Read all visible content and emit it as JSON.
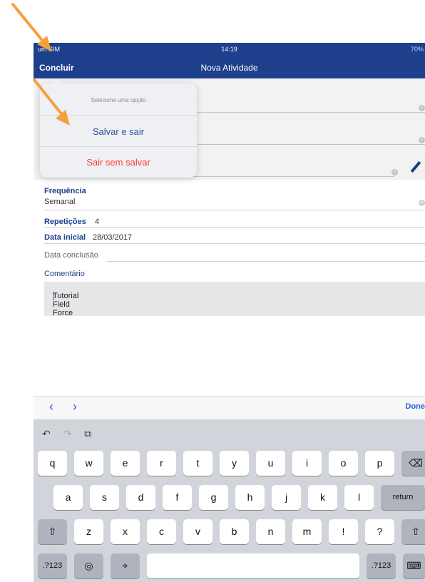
{
  "status": {
    "carrier": "um SIM",
    "time": "14:19",
    "battery": "70%"
  },
  "nav": {
    "left_button": "Concluir",
    "title": "Nova Atividade"
  },
  "popover": {
    "hint": "Selecione uma opção",
    "save_exit": "Salvar e sair",
    "exit_no_save": "Sair sem salvar"
  },
  "form": {
    "frequencia_label": "Frequência",
    "frequencia_value": "Semanal",
    "repeticoes_label": "Repetições",
    "repeticoes_value": "4",
    "data_inicial_label": "Data inicial",
    "data_inicial_value": "28/03/2017",
    "data_conclusao_label": "Data conclusão",
    "comentario_label": "Comentário",
    "comentario_value": "Tutorial Field Force"
  },
  "accessory": {
    "prev": "‹",
    "next": "›",
    "done": "Done"
  },
  "keyboard": {
    "row1": [
      "q",
      "w",
      "e",
      "r",
      "t",
      "y",
      "u",
      "i",
      "o",
      "p"
    ],
    "row2": [
      "a",
      "s",
      "d",
      "f",
      "g",
      "h",
      "j",
      "k",
      "l"
    ],
    "row3": [
      "z",
      "x",
      "c",
      "v",
      "b",
      "n",
      "m",
      "!",
      "?"
    ],
    "return": "return",
    "mode": ".?123"
  },
  "colors": {
    "nav": "#1d3f8c",
    "accent_blue": "#2b62d8",
    "danger": "#ff3b30",
    "annotation_arrow": "#f4a03a"
  }
}
